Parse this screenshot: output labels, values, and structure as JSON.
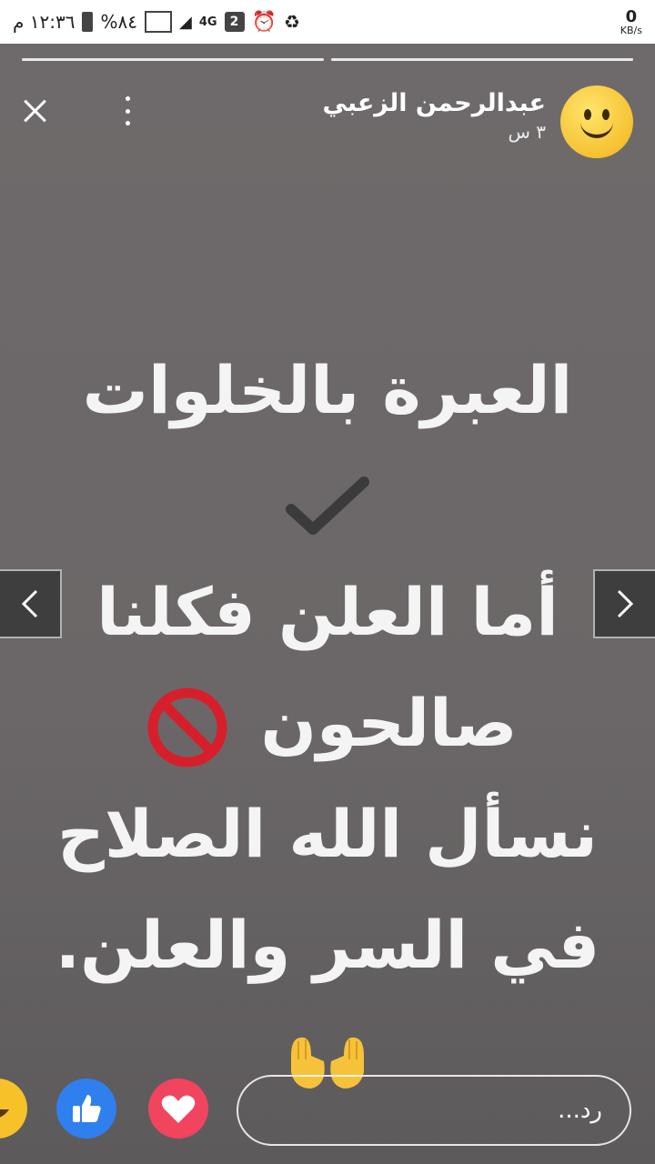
{
  "statusbar": {
    "time": "١٢:٣٦ م",
    "battery": "%٨٤",
    "network": "4G",
    "sim": "2",
    "speed_value": "0",
    "speed_unit": "KB/s"
  },
  "story": {
    "author_name": "عبدالرحمن الزعبي",
    "time_ago": "٣ س",
    "progress_segments": 2,
    "lines": [
      "العبرة بالخلوات",
      "أما العلن فكلنا",
      "صالحون",
      "نسأل الله الصلاح",
      "في السر والعلن."
    ],
    "icons": {
      "line1": "checkmark-icon",
      "line3": "no-entry-icon",
      "line5": "open-hands-icon"
    }
  },
  "navigation": {
    "prev_icon": "chevron-left-icon",
    "next_icon": "chevron-right-icon"
  },
  "footer": {
    "reply_placeholder": "رد...",
    "reactions": [
      "love-icon",
      "like-icon",
      "haha-icon"
    ]
  },
  "colors": {
    "background": "#6f6b6c",
    "like_blue": "#2f80ee",
    "love_red": "#f0445f",
    "haha_yellow": "#f7c229"
  }
}
